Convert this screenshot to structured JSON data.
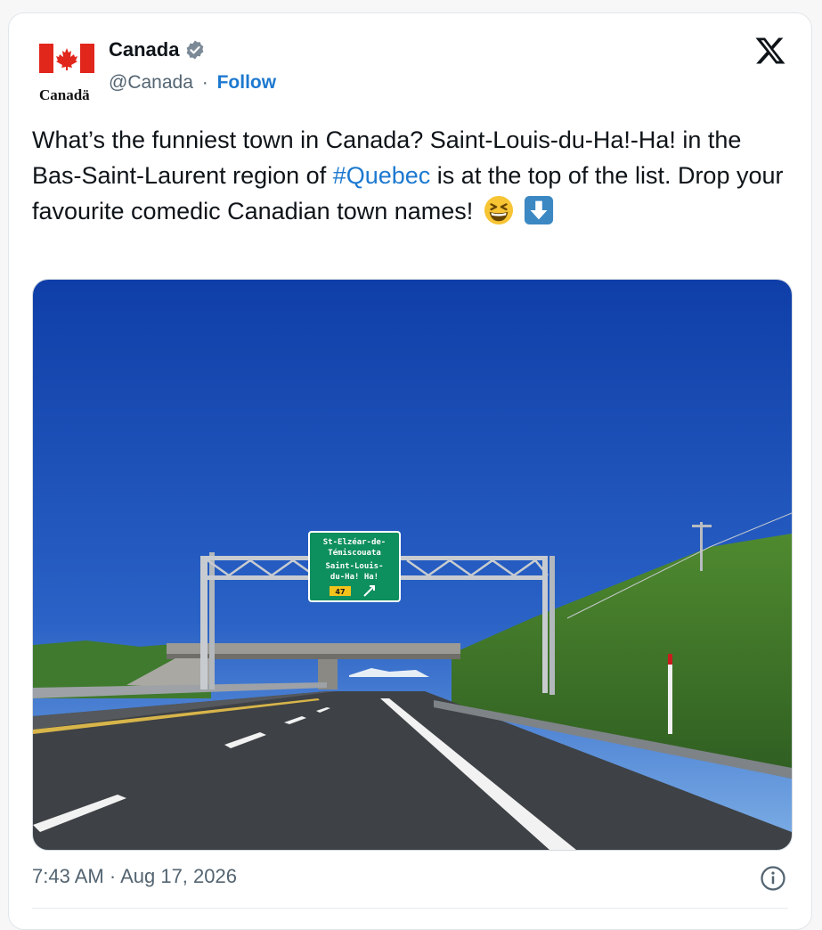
{
  "account": {
    "display_name": "Canada",
    "handle": "@Canada",
    "separator": "·",
    "follow_label": "Follow",
    "wordmark": "Canadä"
  },
  "tweet": {
    "text_part1": "What’s the funniest town in Canada? Saint-Louis-du-Ha!-Ha! in the Bas-Saint-Laurent region of ",
    "hashtag": "#Quebec",
    "text_part2": " is at the top of the list. Drop your favourite comedic Canadian town names!",
    "emoji_1": "grinning-squinting-face",
    "emoji_2": "down-arrow-button"
  },
  "media": {
    "sign_line1": "St-Elzéar-de-",
    "sign_line2": "Témiscouata",
    "sign_line3": "Saint-Louis-",
    "sign_line4": "du-Ha! Ha!",
    "sign_exit": "47"
  },
  "footer": {
    "time": "7:43 AM",
    "separator": "·",
    "date": "Aug 17, 2026"
  },
  "colors": {
    "link": "#1d79d0",
    "text": "#0f1419",
    "muted": "#536471",
    "flag_red": "#e1261c",
    "sky": "#1a4bb5",
    "sign_green": "#0e8f5e"
  }
}
